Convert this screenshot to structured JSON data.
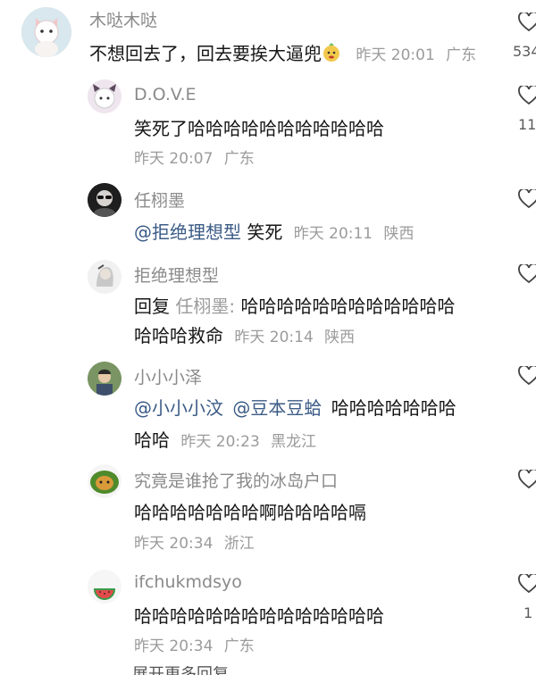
{
  "comments": [
    {
      "username": "木哒木哒",
      "text": "不想回去了，回去要挨大逼兜",
      "time": "昨天 20:01",
      "location": "广东",
      "like_count": "534"
    },
    {
      "username": "D.O.V.E",
      "text": "笑死了哈哈哈哈哈哈哈哈哈哈哈",
      "time": "昨天 20:07",
      "location": "广东",
      "like_count": "11"
    },
    {
      "username": "任栩墨",
      "mention": "@拒绝理想型",
      "text": "笑死",
      "time": "昨天 20:11",
      "location": "陕西"
    },
    {
      "username": "拒绝理想型",
      "reply_prefix": "回复",
      "reply_target": "任栩墨:",
      "text_line1": "哈哈哈哈哈哈哈哈哈哈哈哈",
      "text_line2": "哈哈哈救命",
      "time": "昨天 20:14",
      "location": "陕西"
    },
    {
      "username": "小小小泽",
      "mention1": "@小小小汶",
      "mention2": "@豆本豆蛤",
      "text_line1": "哈哈哈哈哈哈哈",
      "text_line2": "哈哈",
      "time": "昨天 20:23",
      "location": "黑龙江"
    },
    {
      "username": "究竟是谁抢了我的冰岛户口",
      "text": "哈哈哈哈哈哈哈啊哈哈哈哈嗝",
      "time": "昨天 20:34",
      "location": "浙江"
    },
    {
      "username": "ifchukmdsyo",
      "text": "哈哈哈哈哈哈哈哈哈哈哈哈哈哈",
      "time": "昨天 20:34",
      "location": "广东",
      "like_count": "1"
    }
  ],
  "bottom_partial_text": "展开更多回复"
}
